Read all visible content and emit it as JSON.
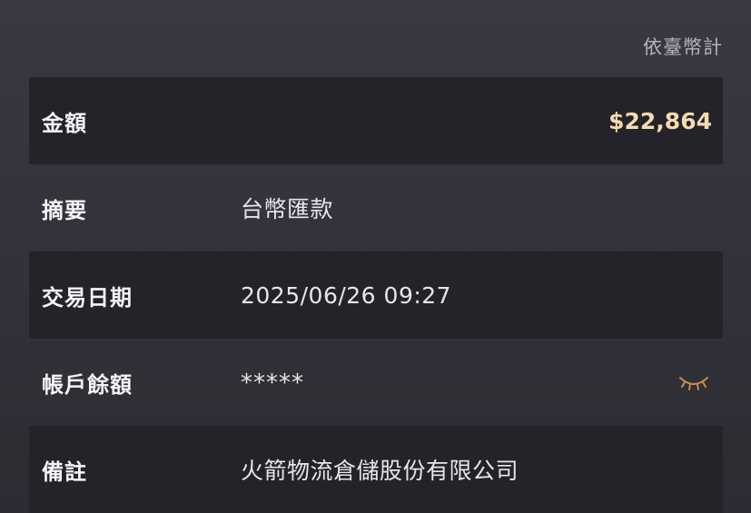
{
  "header": {
    "currency_note": "依臺幣計"
  },
  "details": {
    "amount": {
      "label": "金額",
      "value": "$22,864"
    },
    "summary": {
      "label": "摘要",
      "value": "台幣匯款"
    },
    "transaction_date": {
      "label": "交易日期",
      "value": "2025/06/26 09:27"
    },
    "account_balance": {
      "label": "帳戶餘額",
      "value": "*****",
      "toggle_icon": "eye-closed-icon"
    },
    "remarks": {
      "label": "備註",
      "value": "火箭物流倉儲股份有限公司"
    }
  },
  "colors": {
    "amount": "#f5d9b0",
    "eye_icon": "#c98b4e",
    "row_dark": "#232329"
  }
}
